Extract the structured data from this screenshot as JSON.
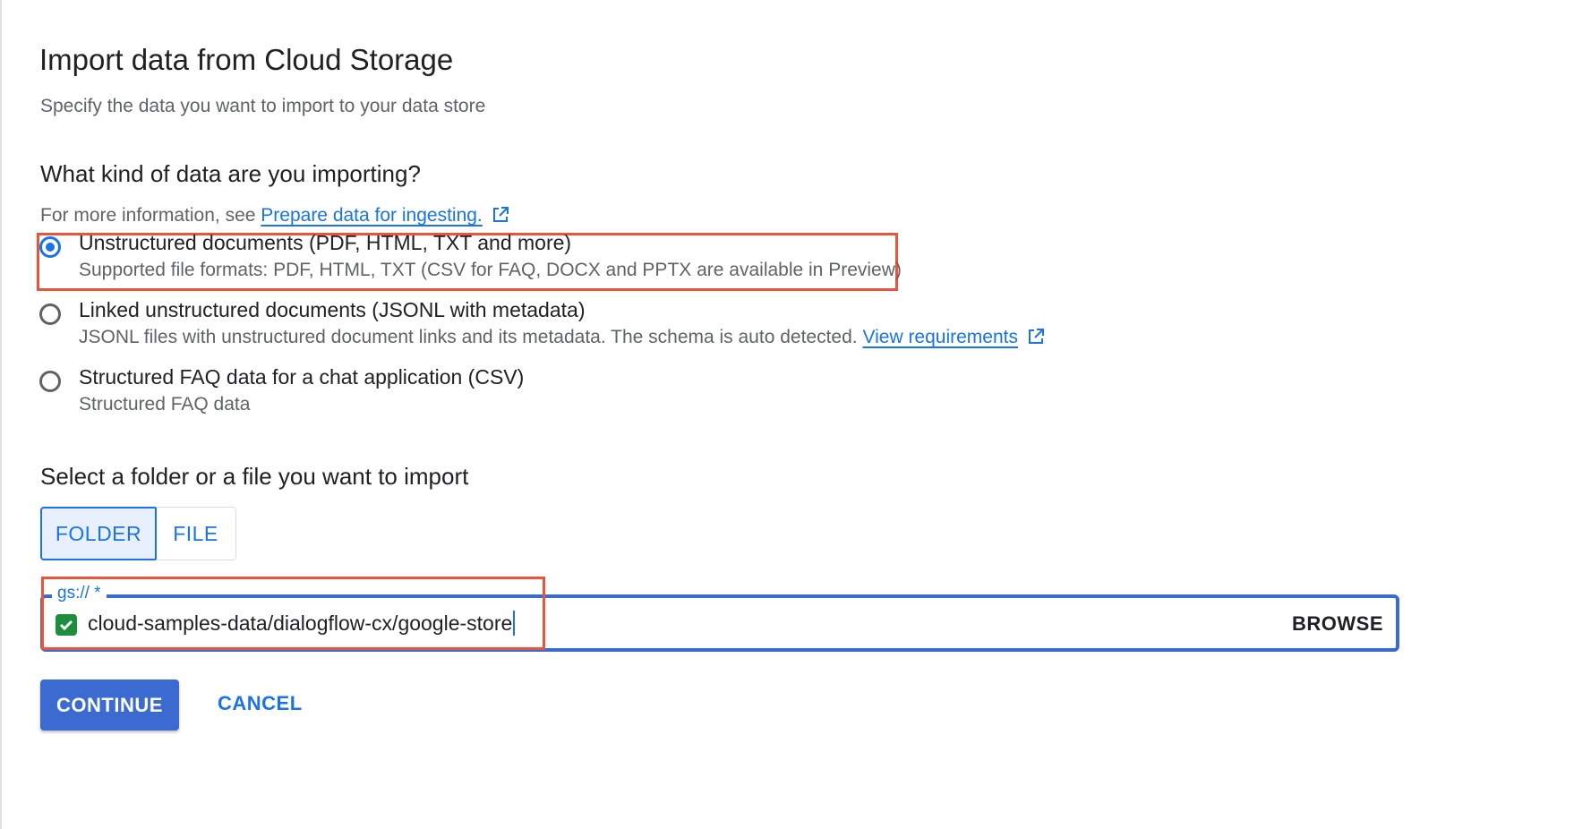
{
  "dialog": {
    "title": "Import data from Cloud Storage",
    "subtitle": "Specify the data you want to import to your data store"
  },
  "data_kind": {
    "heading": "What kind of data are you importing?",
    "info_prefix": "For more information, see",
    "info_link": "Prepare data for ingesting.",
    "options": [
      {
        "label": "Unstructured documents (PDF, HTML, TXT and more)",
        "description": "Supported file formats: PDF, HTML, TXT (CSV for FAQ, DOCX and PPTX are available in Preview)",
        "selected": true
      },
      {
        "label": "Linked unstructured documents (JSONL with metadata)",
        "description": "JSONL files with unstructured document links and its metadata. The schema is auto detected.",
        "link": "View requirements",
        "selected": false
      },
      {
        "label": "Structured FAQ data for a chat application (CSV)",
        "description": "Structured FAQ data",
        "selected": false
      }
    ]
  },
  "source": {
    "heading": "Select a folder or a file you want to import",
    "folder_label": "FOLDER",
    "file_label": "FILE",
    "selected_toggle": "FOLDER",
    "field_label": "gs:// *",
    "field_value": "cloud-samples-data/dialogflow-cx/google-store",
    "browse_label": "BROWSE"
  },
  "actions": {
    "continue_label": "CONTINUE",
    "cancel_label": "CANCEL"
  },
  "colors": {
    "accent": "#1a73e8",
    "highlight": "#e8553a",
    "success": "#1e8e3e"
  }
}
